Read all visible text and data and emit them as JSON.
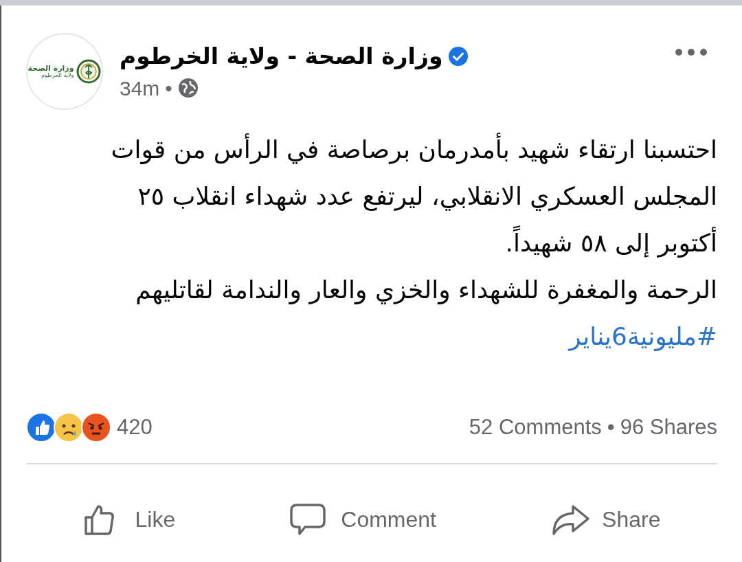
{
  "post": {
    "avatar": {
      "logo_lines": [
        "وزارة الصحة",
        "ولاية الخرطوم"
      ]
    },
    "author": "وزارة الصحة - ولاية الخرطوم",
    "verified": true,
    "time": "34m",
    "separator": "•",
    "paragraphs": [
      [
        "احتسبنا ارتقاء شهيد بأمدرمان برصاصة في الرأس من قوات",
        "المجلس العسكري الانقلابي، ليرتفع عدد شهداء انقلاب ٢٥",
        "أكتوبر إلى ٥٨ شهيداً."
      ],
      [
        "الرحمة والمغفرة للشهداء والخزي والعار والندامة لقاتليهم"
      ]
    ],
    "hashtag": "#مليونية6يناير",
    "reactions": {
      "count": "420",
      "comments": "52 Comments",
      "separator": "•",
      "shares": "96 Shares"
    },
    "actions": {
      "like": "Like",
      "comment": "Comment",
      "share": "Share"
    }
  }
}
